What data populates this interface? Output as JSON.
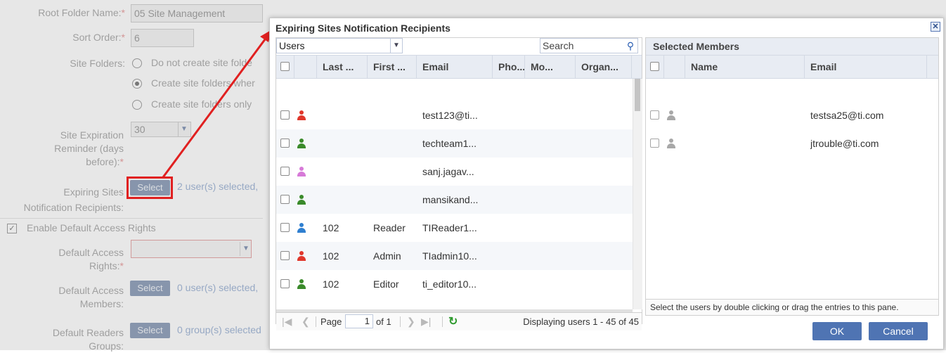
{
  "form": {
    "root_folder_label": "Root Folder Name:",
    "root_folder_value": "05 Site Management",
    "sort_order_label": "Sort Order:",
    "sort_order_value": "6",
    "site_folders_label": "Site Folders:",
    "site_folders_options": [
      "Do not create site folde",
      "Create site folders wher",
      "Create site folders only"
    ],
    "site_folders_selected": 1,
    "expiration_label_1": "Site Expiration",
    "expiration_label_2": "Reminder (days",
    "expiration_label_3": "before):",
    "expiration_value": "30",
    "expiring_label_1": "Expiring Sites",
    "expiring_label_2": "Notification Recipients:",
    "expiring_button": "Select",
    "expiring_selected": "2 user(s) selected,",
    "enable_default_access": "Enable Default Access Rights",
    "default_access_rights_label_1": "Default Access",
    "default_access_rights_label_2": "Rights:",
    "default_access_members_label_1": "Default Access",
    "default_access_members_label_2": "Members:",
    "default_access_members_button": "Select",
    "default_access_members_selected": "0 user(s) selected,",
    "default_readers_label_1": "Default Readers",
    "default_readers_label_2": "Groups:",
    "default_readers_button": "Select",
    "default_readers_selected": "0 group(s) selected",
    "required_mark": "*"
  },
  "dialog": {
    "title": "Expiring Sites Notification Recipients",
    "close_icon": "close-icon",
    "users_select_value": "Users",
    "search_placeholder": "Search",
    "columns": [
      "Last ...",
      "First ...",
      "Email",
      "Pho...",
      "Mo...",
      "Organ..."
    ],
    "rows": [
      {
        "icon_color": "#e0372b",
        "last": "",
        "first": "",
        "email": "test123@ti..."
      },
      {
        "icon_color": "#3a8a2a",
        "last": "",
        "first": "",
        "email": "techteam1..."
      },
      {
        "icon_color": "#d77ad8",
        "last": "",
        "first": "",
        "email": "sanj.jagav..."
      },
      {
        "icon_color": "#3a8a2a",
        "last": "",
        "first": "",
        "email": "mansikand..."
      },
      {
        "icon_color": "#2f7fd0",
        "last": "102",
        "first": "Reader",
        "email": "TIReader1..."
      },
      {
        "icon_color": "#e0372b",
        "last": "102",
        "first": "Admin",
        "email": "TIadmin10..."
      },
      {
        "icon_color": "#3a8a2a",
        "last": "102",
        "first": "Editor",
        "email": "ti_editor10..."
      }
    ],
    "pager": {
      "page_label": "Page",
      "page_value": "1",
      "of_label": "of 1",
      "displaying": "Displaying users 1 - 45 of 45"
    },
    "selected_members": {
      "title": "Selected Members",
      "columns": [
        "Name",
        "Email"
      ],
      "rows": [
        {
          "name": "",
          "email": "testsa25@ti.com"
        },
        {
          "name": "",
          "email": "jtrouble@ti.com"
        }
      ],
      "footer": "Select the users by double clicking or drag the entries to this pane."
    },
    "ok_label": "OK",
    "cancel_label": "Cancel"
  },
  "colors": {
    "accent": "#4f74b3",
    "annotation": "#e02020"
  }
}
